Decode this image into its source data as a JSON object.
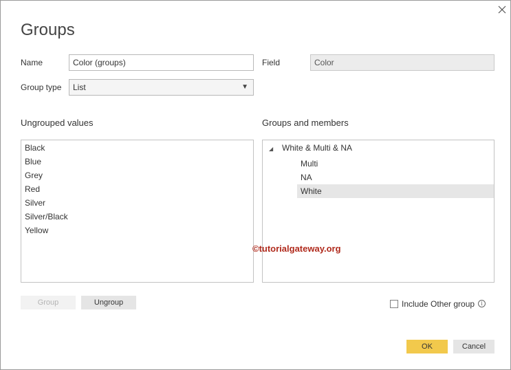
{
  "dialog": {
    "title": "Groups",
    "close_icon": "close-icon"
  },
  "form": {
    "name_label": "Name",
    "name_value": "Color (groups)",
    "field_label": "Field",
    "field_value": "Color",
    "group_type_label": "Group type",
    "group_type_value": "List"
  },
  "ungrouped": {
    "heading": "Ungrouped values",
    "items": [
      "Black",
      "Blue",
      "Grey",
      "Red",
      "Silver",
      "Silver/Black",
      "Yellow"
    ]
  },
  "groups": {
    "heading": "Groups and members",
    "group_name": "White & Multi & NA",
    "members": [
      "Multi",
      "NA",
      "White"
    ],
    "selected_member": "White"
  },
  "buttons": {
    "group": "Group",
    "ungroup": "Ungroup",
    "ok": "OK",
    "cancel": "Cancel"
  },
  "include_other": {
    "label": "Include Other group",
    "checked": false
  },
  "watermark": "©tutorialgateway.org",
  "colors": {
    "accent": "#f2c94c",
    "selection": "#e6e6e6",
    "watermark": "#b02a1c"
  }
}
